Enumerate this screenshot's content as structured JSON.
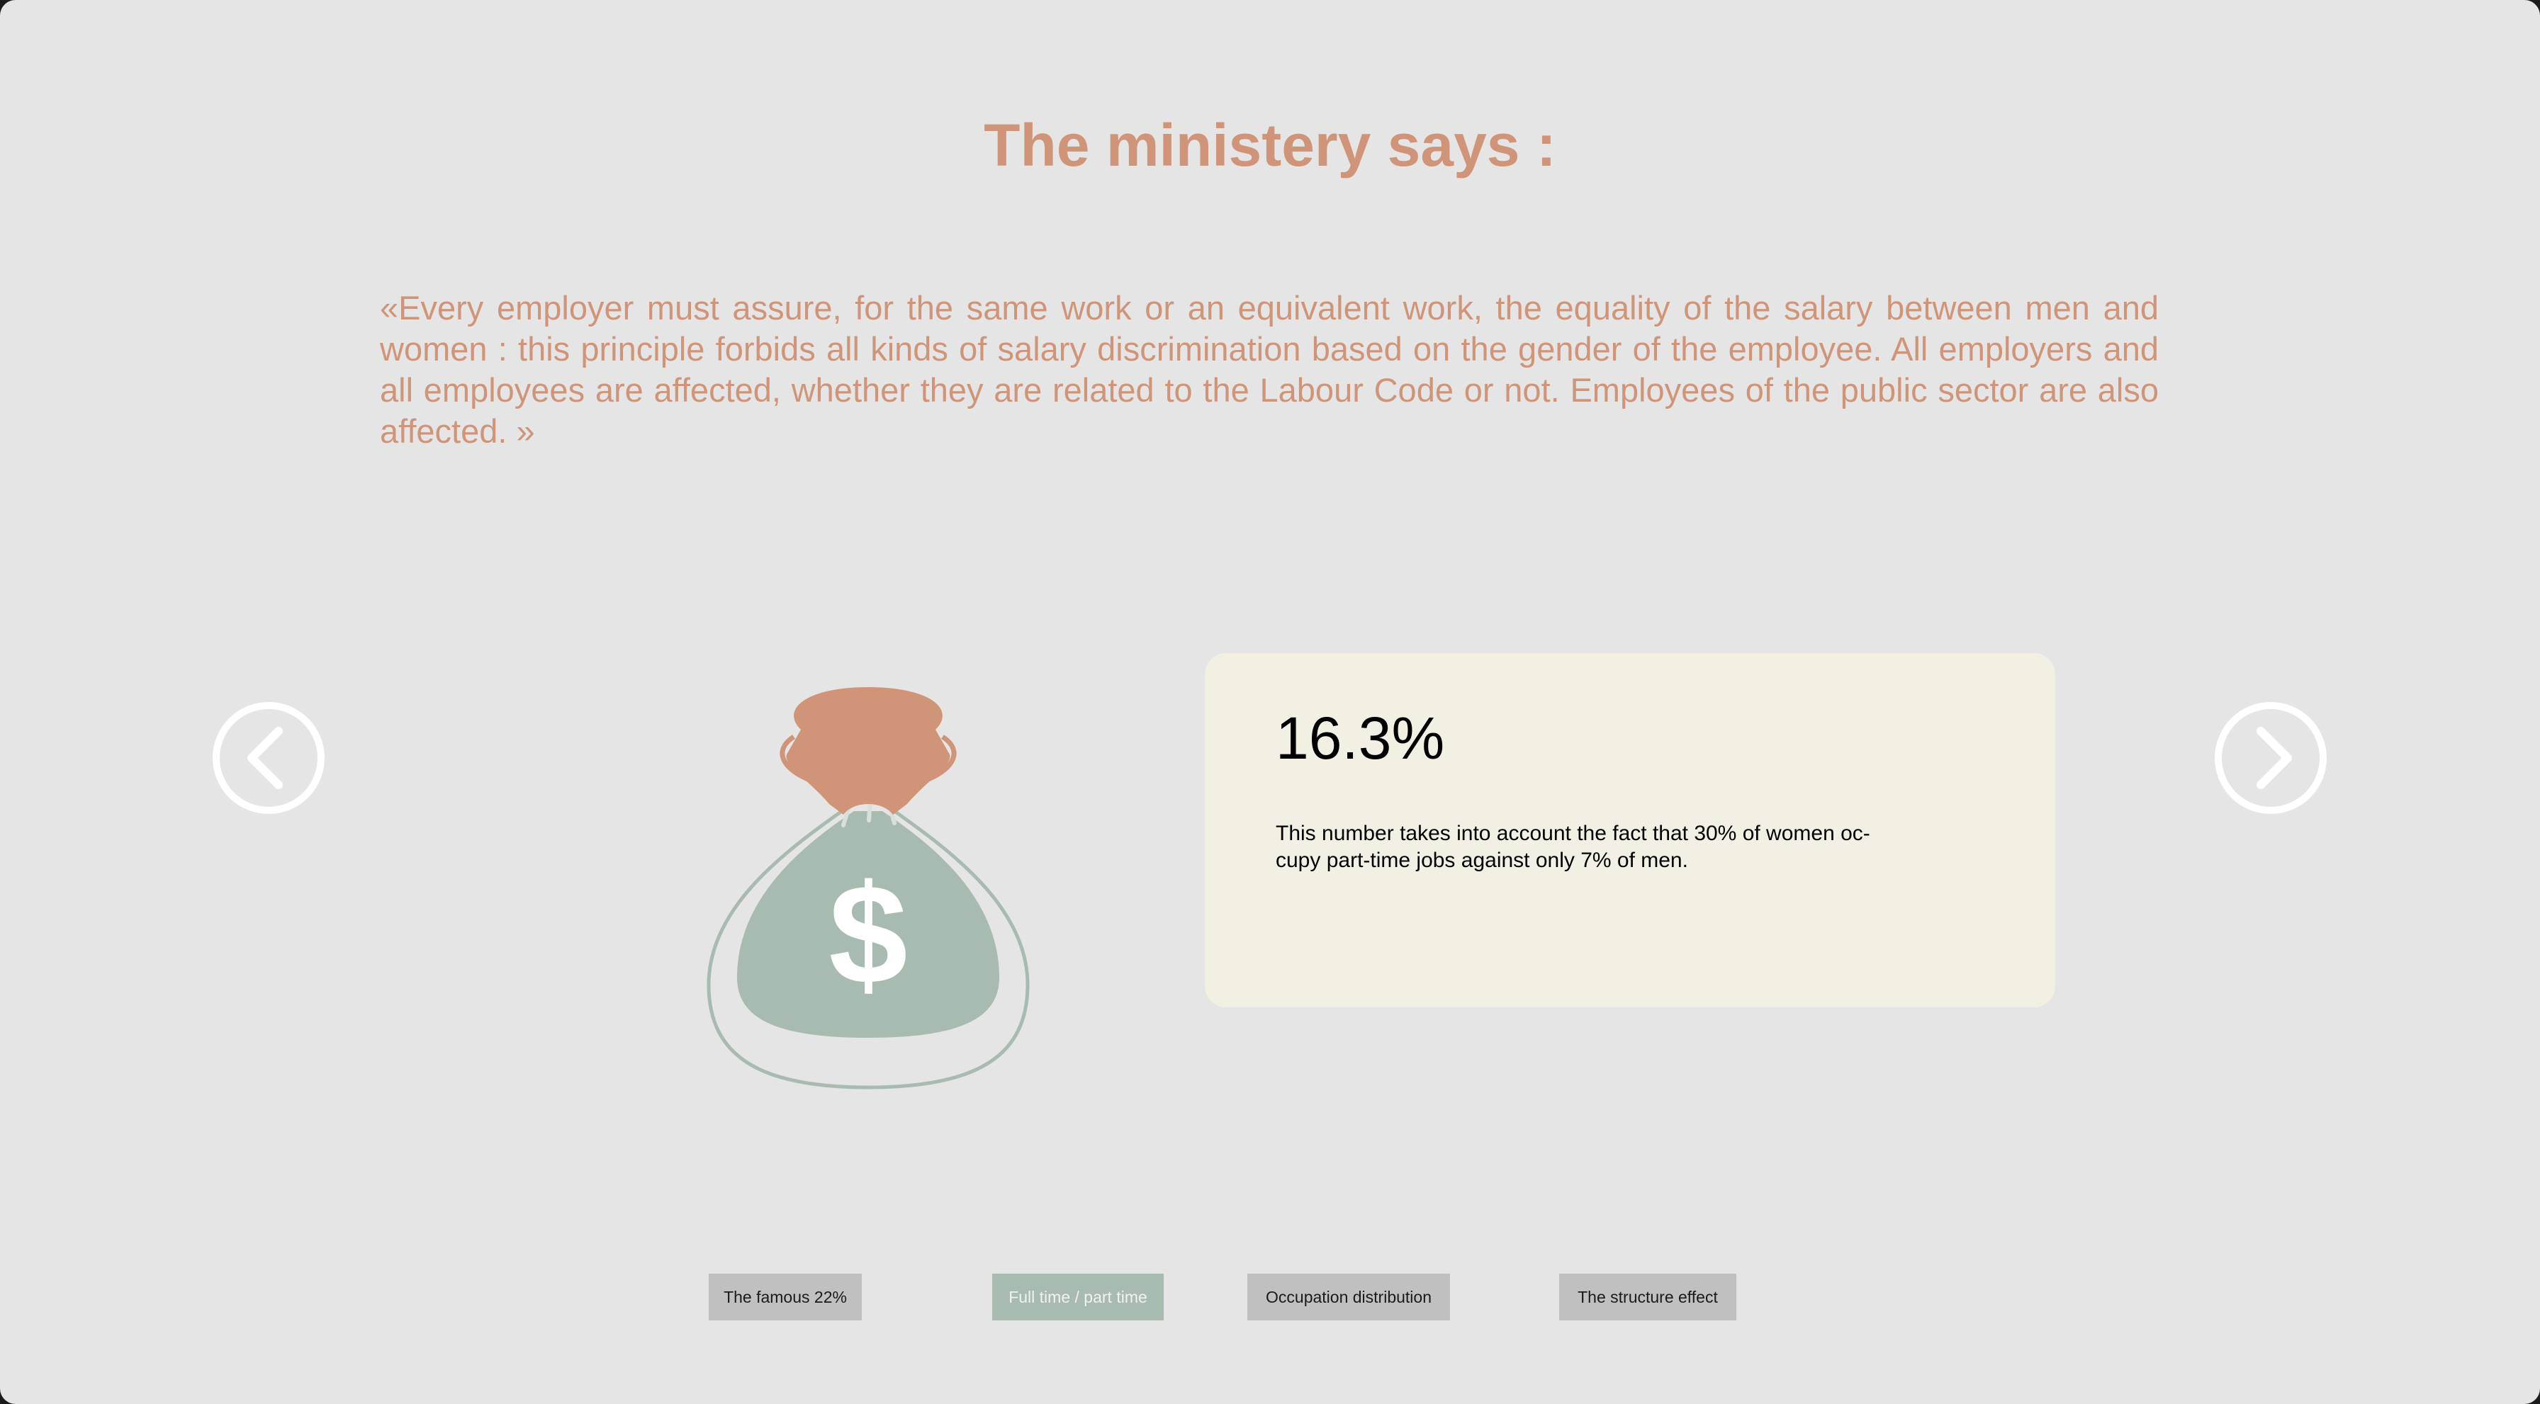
{
  "header": {
    "title": "The ministery says :"
  },
  "quote": {
    "text": "«Every employer must assure, for the same work or an equivalent work, the equality of the salary between men and women : this principle forbids all kinds of salary discrimination based on the gender of the employee. All employers and all employees are affected, whether they are related to the Labour Code or not. Employees of the public sector are also affected. »"
  },
  "navigation": {
    "prev_icon": "chevron-left-circle",
    "next_icon": "chevron-right-circle"
  },
  "illustration": {
    "icon": "money-bag-dollar",
    "symbol": "$"
  },
  "card": {
    "value": "16.3%",
    "description": "This number takes into account the fact that 30% of women oc-cupy part-time jobs against only 7% of men."
  },
  "tabs": [
    {
      "label": "The famous 22%",
      "active": false
    },
    {
      "label": "Full time / part time",
      "active": true
    },
    {
      "label": "Occupation distribution",
      "active": false
    },
    {
      "label": "The structure effect",
      "active": false
    }
  ],
  "colors": {
    "background": "#e5e5e5",
    "accent": "#d09578",
    "sage": "#a8bbb1",
    "card": "#f2efe3",
    "tab": "#c0c0c0"
  }
}
